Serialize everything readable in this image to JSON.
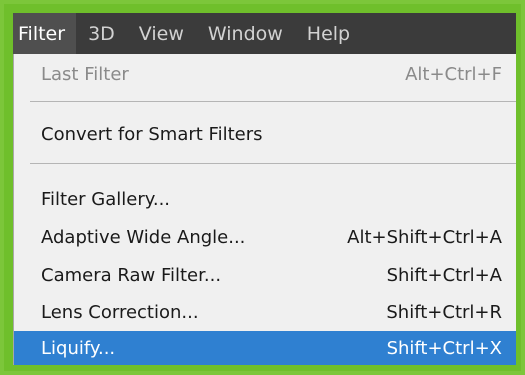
{
  "menubar": {
    "items": [
      {
        "label": "Filter",
        "active": true
      },
      {
        "label": "3D"
      },
      {
        "label": "View"
      },
      {
        "label": "Window"
      },
      {
        "label": "Help"
      }
    ]
  },
  "menu": {
    "last_filter": {
      "label": "Last Filter",
      "shortcut": "Alt+Ctrl+F",
      "enabled": false
    },
    "convert_smart": {
      "label": "Convert for Smart Filters",
      "shortcut": ""
    },
    "filter_gallery": {
      "label": "Filter Gallery...",
      "shortcut": ""
    },
    "adaptive_wide": {
      "label": "Adaptive Wide Angle...",
      "shortcut": "Alt+Shift+Ctrl+A"
    },
    "camera_raw": {
      "label": "Camera Raw Filter...",
      "shortcut": "Shift+Ctrl+A"
    },
    "lens_correction": {
      "label": "Lens Correction...",
      "shortcut": "Shift+Ctrl+R"
    },
    "liquify": {
      "label": "Liquify...",
      "shortcut": "Shift+Ctrl+X",
      "selected": true
    }
  },
  "colors": {
    "frame_border": "#7cc63a",
    "menubar_bg": "#3b3b3b",
    "menu_bg": "#f0f0f0",
    "highlight": "#2f80d1"
  }
}
